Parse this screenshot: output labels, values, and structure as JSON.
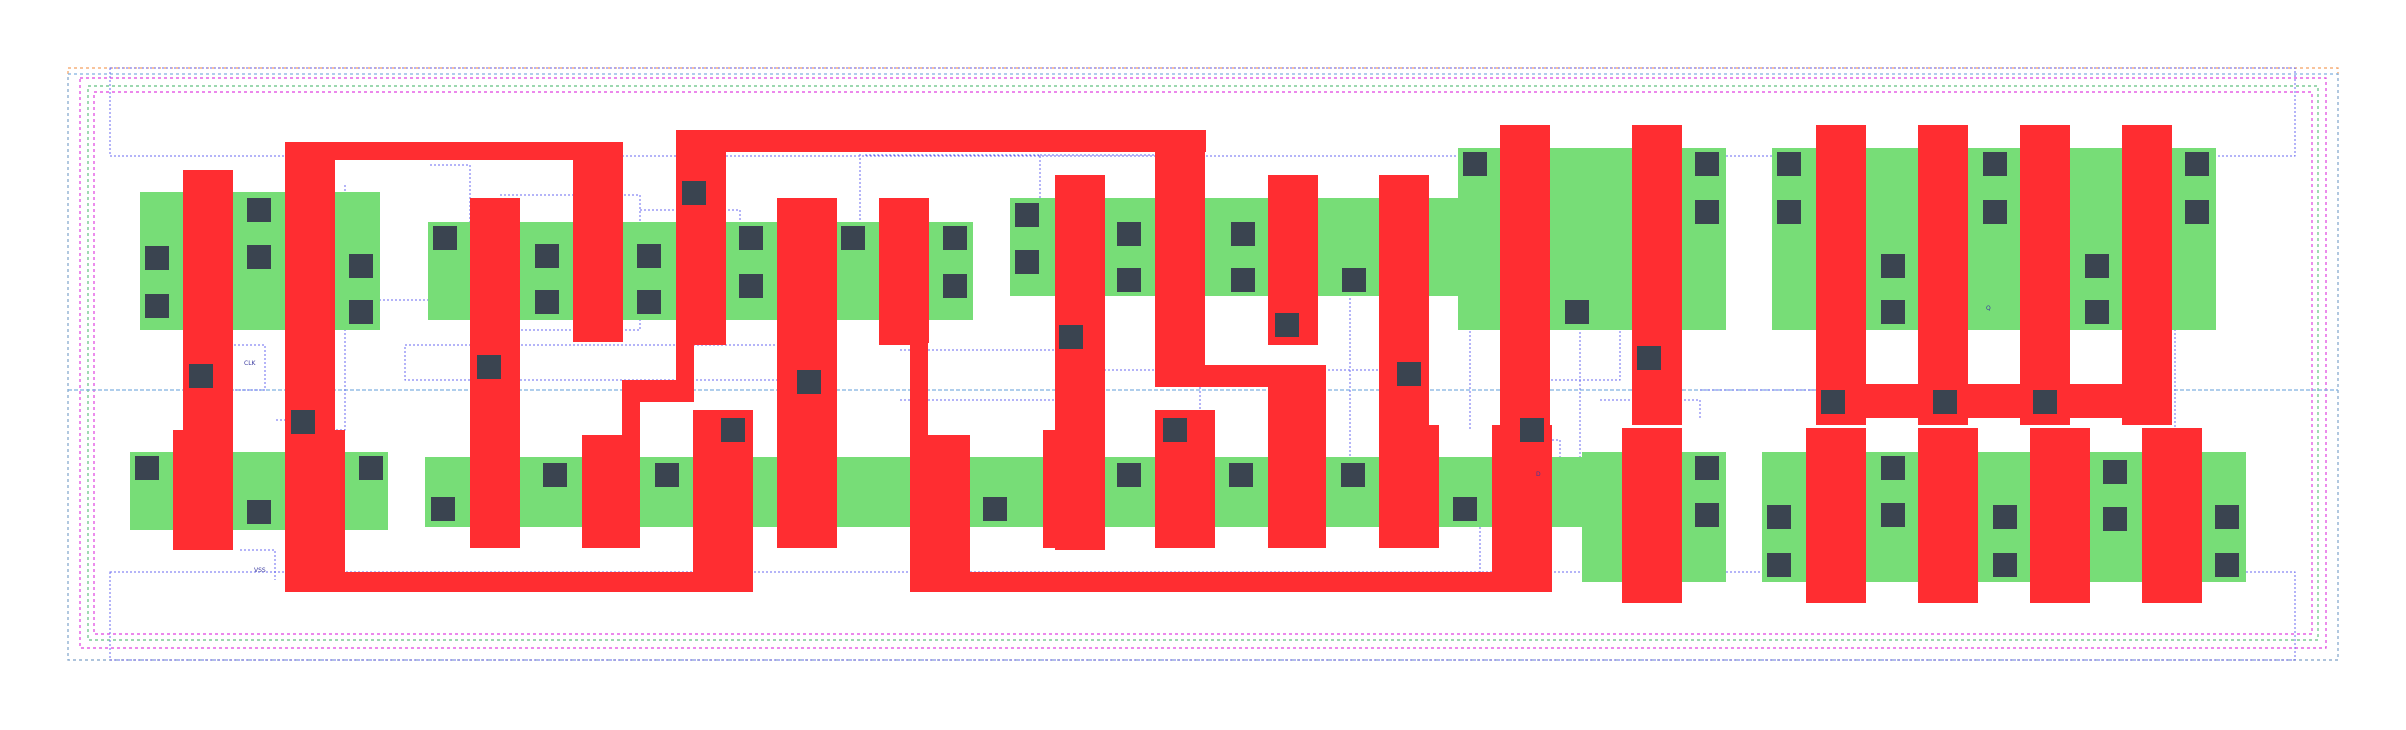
{
  "labels": {
    "clk": "CLK",
    "vss": "VSS",
    "q": "Q",
    "d": "D"
  },
  "colors": {
    "diffusion": "#77dd77",
    "poly": "#ff2d31",
    "contact": "#3a4450",
    "metal_outline": "#6a6af0",
    "boundary_orange": "#f4a060",
    "boundary_magenta": "#e040e0",
    "boundary_blue": "#7fb0e0",
    "boundary_green": "#60c080"
  },
  "legend": []
}
